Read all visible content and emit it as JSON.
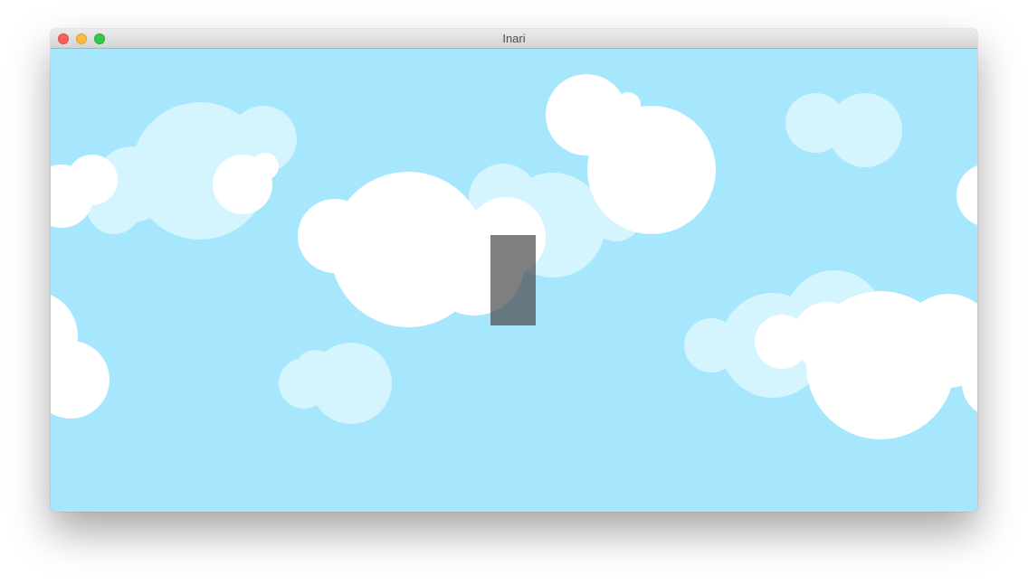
{
  "window": {
    "title": "Inari"
  },
  "colors": {
    "sky": "#a6e7fd",
    "cloud_far": "#d4f4fe",
    "cloud_near": "#ffffff",
    "player": "#6b6b6b",
    "titlebar": "#dddddd"
  },
  "scene": {
    "player": {
      "name": "player-block",
      "color": "#5a5a5a"
    }
  }
}
